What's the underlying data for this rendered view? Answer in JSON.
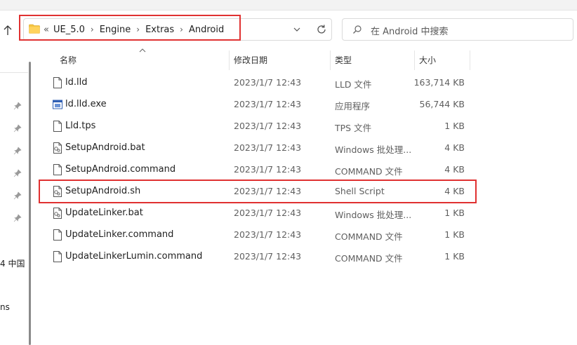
{
  "address": {
    "lead": "«",
    "crumbs": [
      "UE_5.0",
      "Engine",
      "Extras",
      "Android"
    ]
  },
  "search": {
    "placeholder": "在 Android 中搜索"
  },
  "columns": {
    "name": "名称",
    "date": "修改日期",
    "type": "类型",
    "size": "大小"
  },
  "sidebar": {
    "fragments": [
      "4 中国",
      "ns"
    ]
  },
  "files": [
    {
      "name": "ld.lld",
      "date": "2023/1/7 12:43",
      "type": "LLD 文件",
      "size": "163,714 KB",
      "icon": "file-icon"
    },
    {
      "name": "ld.lld.exe",
      "date": "2023/1/7 12:43",
      "type": "应用程序",
      "size": "56,744 KB",
      "icon": "exe-icon"
    },
    {
      "name": "Lld.tps",
      "date": "2023/1/7 12:43",
      "type": "TPS 文件",
      "size": "1 KB",
      "icon": "file-icon"
    },
    {
      "name": "SetupAndroid.bat",
      "date": "2023/1/7 12:43",
      "type": "Windows 批处理...",
      "size": "4 KB",
      "icon": "script-icon"
    },
    {
      "name": "SetupAndroid.command",
      "date": "2023/1/7 12:43",
      "type": "COMMAND 文件",
      "size": "4 KB",
      "icon": "file-icon"
    },
    {
      "name": "SetupAndroid.sh",
      "date": "2023/1/7 12:43",
      "type": "Shell Script",
      "size": "4 KB",
      "icon": "script-icon"
    },
    {
      "name": "UpdateLinker.bat",
      "date": "2023/1/7 12:43",
      "type": "Windows 批处理...",
      "size": "1 KB",
      "icon": "script-icon"
    },
    {
      "name": "UpdateLinker.command",
      "date": "2023/1/7 12:43",
      "type": "COMMAND 文件",
      "size": "1 KB",
      "icon": "file-icon"
    },
    {
      "name": "UpdateLinkerLumin.command",
      "date": "2023/1/7 12:43",
      "type": "COMMAND 文件",
      "size": "1 KB",
      "icon": "file-icon"
    }
  ],
  "colors": {
    "highlight": "#e03131",
    "folder": "#f4c542"
  }
}
